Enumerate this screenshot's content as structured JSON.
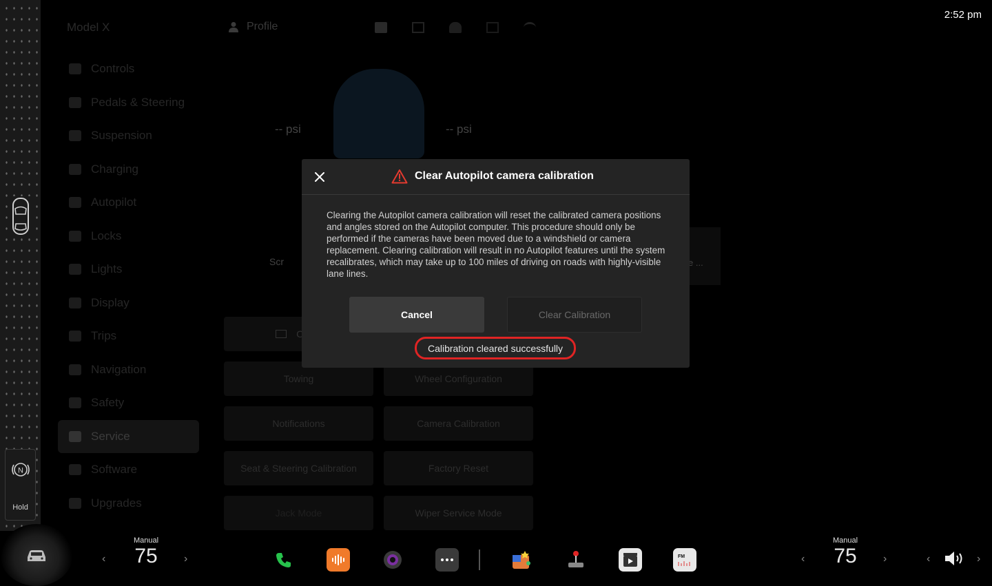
{
  "status": {
    "time": "2:52 pm"
  },
  "header": {
    "vehicle": "Model X",
    "profile": "Profile"
  },
  "sidebar": {
    "items": [
      {
        "label": "Controls"
      },
      {
        "label": "Pedals & Steering"
      },
      {
        "label": "Suspension"
      },
      {
        "label": "Charging"
      },
      {
        "label": "Autopilot"
      },
      {
        "label": "Locks"
      },
      {
        "label": "Lights"
      },
      {
        "label": "Display"
      },
      {
        "label": "Trips"
      },
      {
        "label": "Navigation"
      },
      {
        "label": "Safety"
      },
      {
        "label": "Service"
      },
      {
        "label": "Software"
      },
      {
        "label": "Upgrades"
      }
    ],
    "active": "Service"
  },
  "tires": {
    "left_psi": "-- psi",
    "right_psi": "-- psi"
  },
  "service_tiles": {
    "partial_left": "Scr",
    "partial_right": "e ...",
    "owners": "Owne",
    "towing": "Towing",
    "wheel_config": "Wheel Configuration",
    "notifications": "Notifications",
    "camera_calibration": "Camera Calibration",
    "seat_steering": "Seat & Steering Calibration",
    "factory_reset": "Factory Reset",
    "jack_mode": "Jack Mode",
    "wiper_service": "Wiper Service Mode"
  },
  "modal": {
    "title": "Clear Autopilot camera calibration",
    "body": "Clearing the Autopilot camera calibration will reset the calibrated camera positions and angles stored on the Autopilot computer. This procedure should only be performed if the cameras have been moved due to a windshield or camera replacement. Clearing calibration will result in no Autopilot features until the system recalibrates, which may take up to 100 miles of driving on roads with highly-visible lane lines.",
    "cancel_label": "Cancel",
    "clear_label": "Clear Calibration",
    "status": "Calibration cleared successfully"
  },
  "left_rail": {
    "hold_label": "Hold"
  },
  "climate": {
    "left": {
      "mode": "Manual",
      "temp": "75"
    },
    "right": {
      "mode": "Manual",
      "temp": "75"
    }
  },
  "colors": {
    "accent_red": "#e02424",
    "phone_green": "#27c24c",
    "audio_orange": "#f07a2a"
  }
}
